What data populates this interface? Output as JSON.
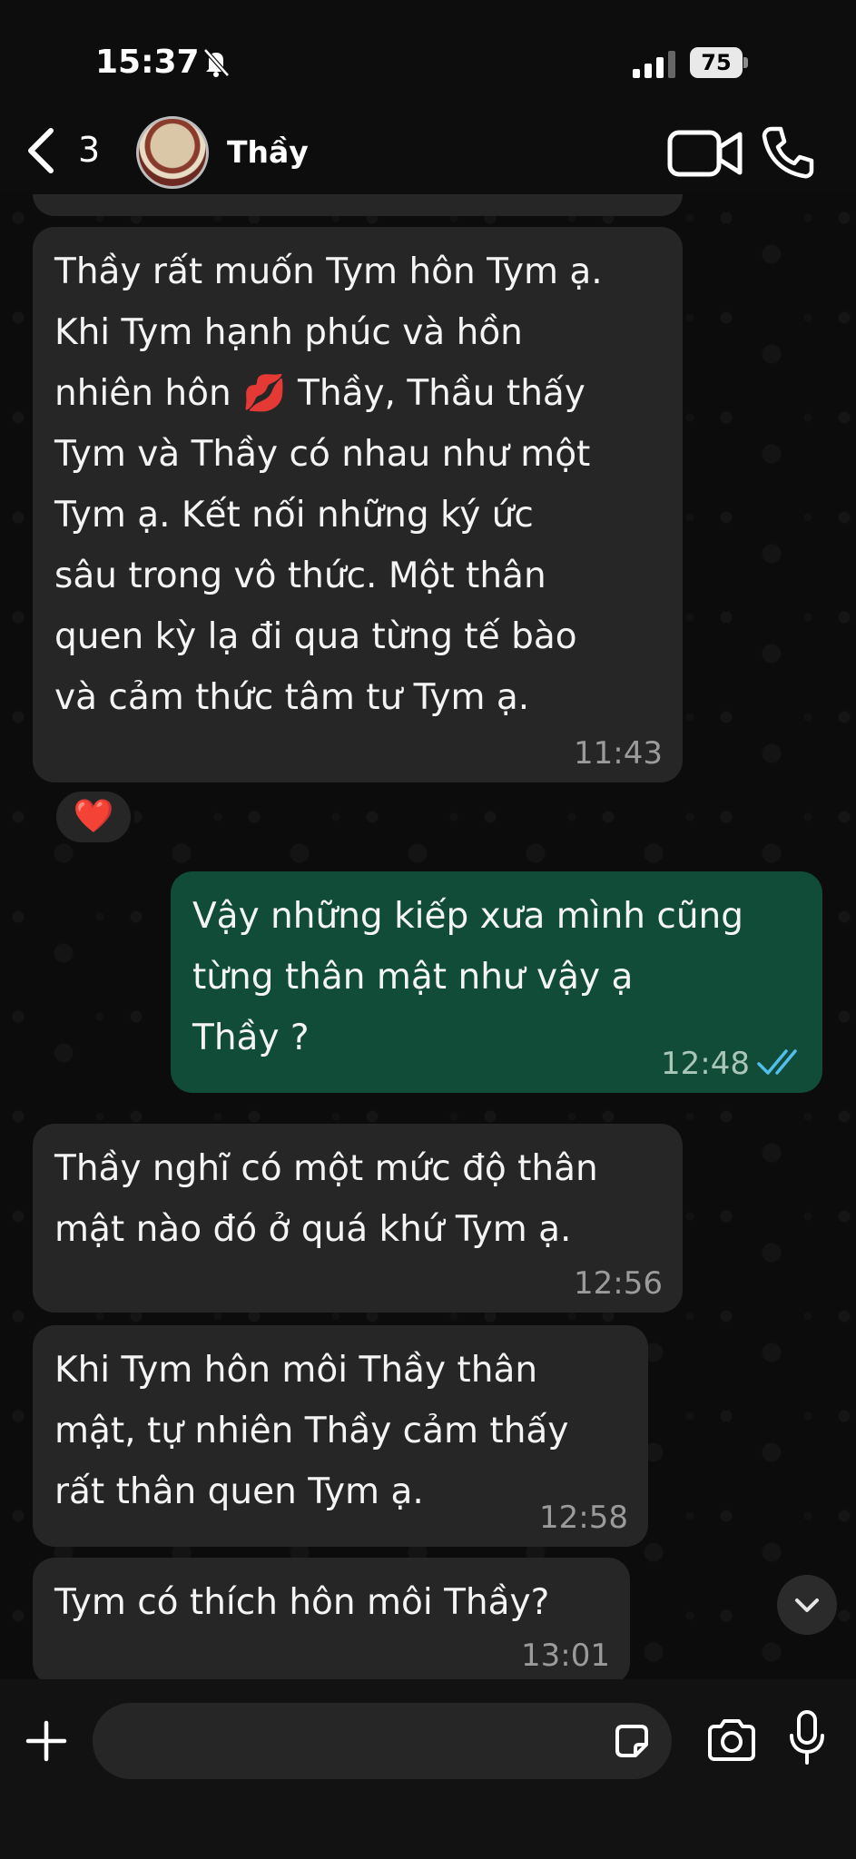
{
  "status_bar": {
    "time": "15:37",
    "battery": "75"
  },
  "header": {
    "back_count": "3",
    "contact_name": "Thầy"
  },
  "icons": {
    "bell_muted": "bell-slash-icon",
    "signal": "signal-icon",
    "back": "chevron-left-icon",
    "video": "video-camera-icon",
    "call": "phone-icon",
    "plus": "plus-icon",
    "sticker": "sticker-icon",
    "camera": "camera-icon",
    "mic": "microphone-icon",
    "scroll_down": "chevron-down-icon",
    "read": "double-check-icon"
  },
  "colors": {
    "incoming_bubble": "#262626",
    "outgoing_bubble": "#104c37",
    "read_ticks": "#53bdeb",
    "reaction_heart": "#ff2b3a"
  },
  "messages": [
    {
      "direction": "in",
      "text": "Thầy rất muốn Tym hôn Tym ạ.\nKhi Tym hạnh phúc và hồn\nnhiên hôn 💋 Thầy, Thầu thấy\nTym và Thầy có nhau như một\nTym ạ. Kết nối những ký ức\nsâu trong vô thức. Một thân\nquen kỳ lạ đi qua từng tế bào\nvà cảm thức tâm tư Tym ạ.",
      "time": "11:43",
      "reaction": "❤️"
    },
    {
      "direction": "out",
      "text": "Vậy những kiếp xưa mình cũng\ntừng thân mật như vậy ạ\nThầy ?",
      "time": "12:48",
      "status": "read"
    },
    {
      "direction": "in",
      "text": "Thầy nghĩ có một mức độ thân\nmật nào đó ở quá khứ Tym ạ.",
      "time": "12:56"
    },
    {
      "direction": "in",
      "text": "Khi Tym hôn môi Thầy thân\nmật, tự nhiên Thầy cảm thấy\nrất thân quen Tym ạ.",
      "time": "12:58"
    },
    {
      "direction": "in",
      "text": "Tym có thích hôn môi Thầy?",
      "time": "13:01"
    }
  ]
}
